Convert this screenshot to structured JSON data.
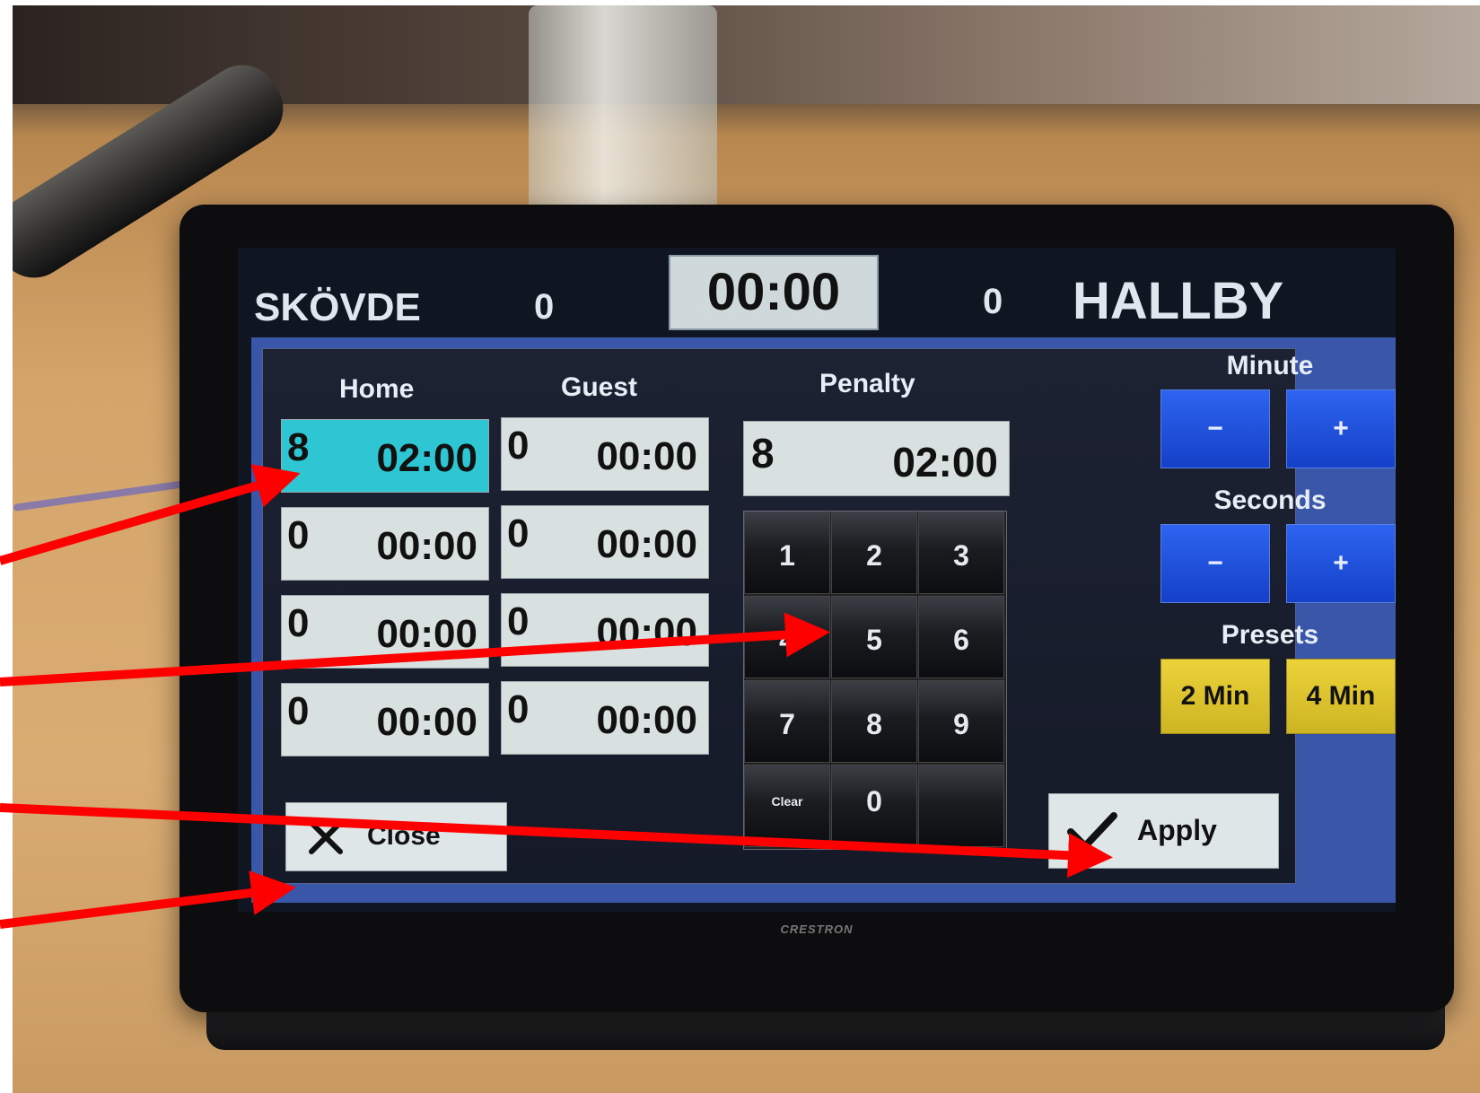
{
  "scoreboard": {
    "home_team": "SKÖVDE",
    "home_score": "0",
    "clock": "00:00",
    "guest_score": "0",
    "guest_team": "HALLBY"
  },
  "columns": {
    "home": "Home",
    "guest": "Guest",
    "penalty": "Penalty",
    "minute": "Minute",
    "seconds": "Seconds",
    "presets": "Presets"
  },
  "home_rows": [
    {
      "player": "8",
      "time": "02:00"
    },
    {
      "player": "0",
      "time": "00:00"
    },
    {
      "player": "0",
      "time": "00:00"
    },
    {
      "player": "0",
      "time": "00:00"
    }
  ],
  "guest_rows": [
    {
      "player": "0",
      "time": "00:00"
    },
    {
      "player": "0",
      "time": "00:00"
    },
    {
      "player": "0",
      "time": "00:00"
    },
    {
      "player": "0",
      "time": "00:00"
    }
  ],
  "penalty_entry": {
    "player": "8",
    "time": "02:00"
  },
  "keypad": [
    "1",
    "2",
    "3",
    "4",
    "5",
    "6",
    "7",
    "8",
    "9",
    "Clear",
    "0",
    ""
  ],
  "minute_buttons": {
    "minus": "−",
    "plus": "+"
  },
  "seconds_buttons": {
    "minus": "−",
    "plus": "+"
  },
  "presets": {
    "two": "2 Min",
    "four": "4 Min"
  },
  "actions": {
    "close": "Close",
    "apply": "Apply"
  },
  "device_brand": "CRESTRON",
  "colors": {
    "annotation_arrow": "#ff0000",
    "active_cell": "#2dc6d2",
    "preset_button": "#ecd33a",
    "adjust_button": "#2d64f0"
  }
}
